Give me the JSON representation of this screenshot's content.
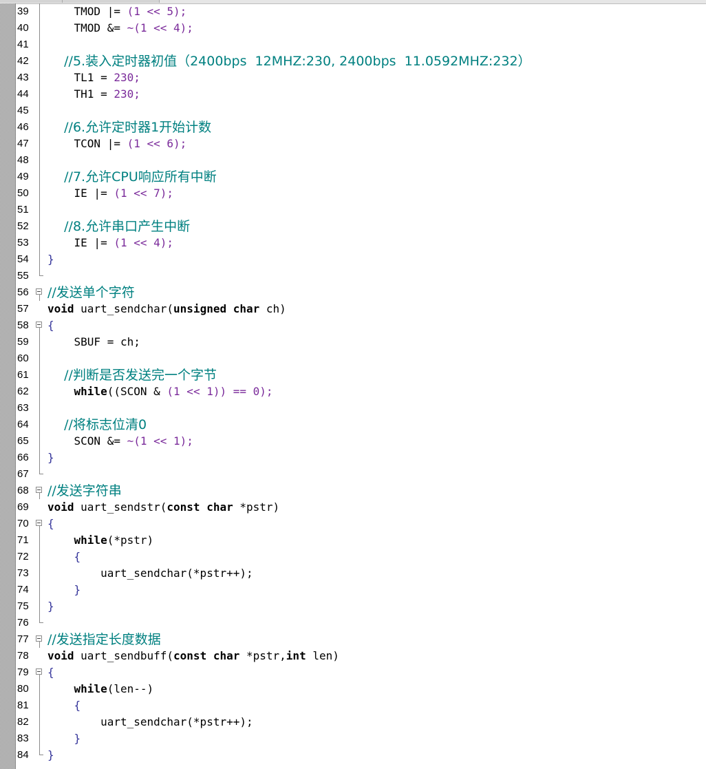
{
  "editor": {
    "lines": [
      {
        "no": "39",
        "fold": "line",
        "tokens": [
          {
            "t": "    TMOD |= ",
            "c": "plain"
          },
          {
            "t": "(1 << 5);",
            "c": "num"
          }
        ]
      },
      {
        "no": "40",
        "fold": "line",
        "tokens": [
          {
            "t": "    TMOD &= ",
            "c": "plain"
          },
          {
            "t": "~(1 << 4);",
            "c": "num"
          }
        ]
      },
      {
        "no": "41",
        "fold": "line",
        "tokens": []
      },
      {
        "no": "42",
        "fold": "line",
        "tokens": [
          {
            "t": "    //5.装入定时器初值（2400bps  12MHZ:230, 2400bps  11.0592MHZ:232）",
            "c": "cmt"
          }
        ]
      },
      {
        "no": "43",
        "fold": "line",
        "tokens": [
          {
            "t": "    TL1 = ",
            "c": "plain"
          },
          {
            "t": "230;",
            "c": "num"
          }
        ]
      },
      {
        "no": "44",
        "fold": "line",
        "tokens": [
          {
            "t": "    TH1 = ",
            "c": "plain"
          },
          {
            "t": "230;",
            "c": "num"
          }
        ]
      },
      {
        "no": "45",
        "fold": "line",
        "tokens": []
      },
      {
        "no": "46",
        "fold": "line",
        "tokens": [
          {
            "t": "    //6.允许定时器1开始计数",
            "c": "cmt"
          }
        ]
      },
      {
        "no": "47",
        "fold": "line",
        "tokens": [
          {
            "t": "    TCON |= ",
            "c": "plain"
          },
          {
            "t": "(1 << 6);",
            "c": "num"
          }
        ]
      },
      {
        "no": "48",
        "fold": "line",
        "tokens": []
      },
      {
        "no": "49",
        "fold": "line",
        "tokens": [
          {
            "t": "    //7.允许CPU响应所有中断",
            "c": "cmt"
          }
        ]
      },
      {
        "no": "50",
        "fold": "line",
        "tokens": [
          {
            "t": "    IE |= ",
            "c": "plain"
          },
          {
            "t": "(1 << 7);",
            "c": "num"
          }
        ]
      },
      {
        "no": "51",
        "fold": "line",
        "tokens": []
      },
      {
        "no": "52",
        "fold": "line",
        "tokens": [
          {
            "t": "    //8.允许串口产生中断",
            "c": "cmt"
          }
        ]
      },
      {
        "no": "53",
        "fold": "line",
        "tokens": [
          {
            "t": "    IE |= ",
            "c": "plain"
          },
          {
            "t": "(1 << 4);",
            "c": "num"
          }
        ]
      },
      {
        "no": "54",
        "fold": "line",
        "tokens": [
          {
            "t": "}",
            "c": "brace"
          }
        ]
      },
      {
        "no": "55",
        "fold": "end",
        "tokens": []
      },
      {
        "no": "56",
        "fold": "box",
        "tokens": [
          {
            "t": "//发送单个字符",
            "c": "cmt"
          }
        ]
      },
      {
        "no": "57",
        "fold": "none",
        "tokens": [
          {
            "t": "void",
            "c": "kw"
          },
          {
            "t": " uart_sendchar(",
            "c": "plain"
          },
          {
            "t": "unsigned char",
            "c": "kw"
          },
          {
            "t": " ch)",
            "c": "plain"
          }
        ]
      },
      {
        "no": "58",
        "fold": "box",
        "tokens": [
          {
            "t": "{",
            "c": "brace"
          }
        ]
      },
      {
        "no": "59",
        "fold": "line",
        "tokens": [
          {
            "t": "    SBUF = ch;",
            "c": "plain"
          }
        ]
      },
      {
        "no": "60",
        "fold": "line",
        "tokens": []
      },
      {
        "no": "61",
        "fold": "line",
        "tokens": [
          {
            "t": "    //判断是否发送完一个字节",
            "c": "cmt"
          }
        ]
      },
      {
        "no": "62",
        "fold": "line",
        "tokens": [
          {
            "t": "    while",
            "c": "kw"
          },
          {
            "t": "((SCON & ",
            "c": "plain"
          },
          {
            "t": "(1 << 1)) == 0);",
            "c": "num"
          }
        ]
      },
      {
        "no": "63",
        "fold": "line",
        "tokens": []
      },
      {
        "no": "64",
        "fold": "line",
        "tokens": [
          {
            "t": "    //将标志位清0",
            "c": "cmt"
          }
        ]
      },
      {
        "no": "65",
        "fold": "line",
        "tokens": [
          {
            "t": "    SCON &= ",
            "c": "plain"
          },
          {
            "t": "~(1 << 1);",
            "c": "num"
          }
        ]
      },
      {
        "no": "66",
        "fold": "line",
        "tokens": [
          {
            "t": "}",
            "c": "brace"
          }
        ]
      },
      {
        "no": "67",
        "fold": "end",
        "tokens": []
      },
      {
        "no": "68",
        "fold": "box",
        "tokens": [
          {
            "t": "//发送字符串",
            "c": "cmt"
          }
        ]
      },
      {
        "no": "69",
        "fold": "none",
        "tokens": [
          {
            "t": "void",
            "c": "kw"
          },
          {
            "t": " uart_sendstr(",
            "c": "plain"
          },
          {
            "t": "const char",
            "c": "kw"
          },
          {
            "t": " *pstr)",
            "c": "plain"
          }
        ]
      },
      {
        "no": "70",
        "fold": "box",
        "tokens": [
          {
            "t": "{",
            "c": "brace"
          }
        ]
      },
      {
        "no": "71",
        "fold": "line",
        "tokens": [
          {
            "t": "    while",
            "c": "kw"
          },
          {
            "t": "(*pstr)",
            "c": "plain"
          }
        ]
      },
      {
        "no": "72",
        "fold": "line",
        "tokens": [
          {
            "t": "    {",
            "c": "brace"
          }
        ]
      },
      {
        "no": "73",
        "fold": "line",
        "tokens": [
          {
            "t": "        uart_sendchar(*pstr++);",
            "c": "plain"
          }
        ]
      },
      {
        "no": "74",
        "fold": "line",
        "tokens": [
          {
            "t": "    }",
            "c": "brace"
          }
        ]
      },
      {
        "no": "75",
        "fold": "line",
        "tokens": [
          {
            "t": "}",
            "c": "brace"
          }
        ]
      },
      {
        "no": "76",
        "fold": "end",
        "tokens": []
      },
      {
        "no": "77",
        "fold": "box",
        "tokens": [
          {
            "t": "//发送指定长度数据",
            "c": "cmt"
          }
        ]
      },
      {
        "no": "78",
        "fold": "none",
        "tokens": [
          {
            "t": "void",
            "c": "kw"
          },
          {
            "t": " uart_sendbuff(",
            "c": "plain"
          },
          {
            "t": "const char",
            "c": "kw"
          },
          {
            "t": " *pstr,",
            "c": "plain"
          },
          {
            "t": "int",
            "c": "kw"
          },
          {
            "t": " len)",
            "c": "plain"
          }
        ]
      },
      {
        "no": "79",
        "fold": "box",
        "tokens": [
          {
            "t": "{",
            "c": "brace"
          }
        ]
      },
      {
        "no": "80",
        "fold": "line",
        "tokens": [
          {
            "t": "    while",
            "c": "kw"
          },
          {
            "t": "(len--)",
            "c": "plain"
          }
        ]
      },
      {
        "no": "81",
        "fold": "line",
        "tokens": [
          {
            "t": "    {",
            "c": "brace"
          }
        ]
      },
      {
        "no": "82",
        "fold": "line",
        "tokens": [
          {
            "t": "        uart_sendchar(*pstr++);",
            "c": "plain"
          }
        ]
      },
      {
        "no": "83",
        "fold": "line",
        "tokens": [
          {
            "t": "    }",
            "c": "brace"
          }
        ]
      },
      {
        "no": "84",
        "fold": "end",
        "tokens": [
          {
            "t": "}",
            "c": "brace"
          }
        ]
      }
    ]
  },
  "colors": {
    "comment": "#008080",
    "number": "#7a2a9a",
    "keyword": "#000000",
    "gutter": "#c8c8c8"
  }
}
